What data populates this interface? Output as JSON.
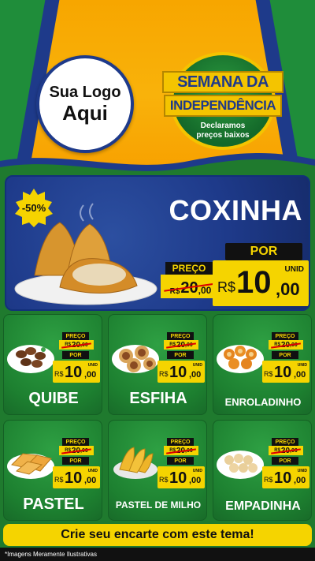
{
  "logo": {
    "line1": "Sua Logo",
    "line2": "Aqui"
  },
  "seal": {
    "line1": "SEMANA DA",
    "line2": "INDEPENDÊNCIA",
    "subtitle_line1": "Declaramos",
    "subtitle_line2": "preços baixos"
  },
  "hero": {
    "discount_badge": "-50%",
    "product_name": "COXINHA",
    "preco_label": "PREÇO",
    "old_price": {
      "currency": "R$",
      "int": "20",
      "dec": ",00"
    },
    "por_label": "POR",
    "unit_label": "UNID",
    "new_price": {
      "currency": "R$",
      "int": "10",
      "dec": ",00"
    }
  },
  "products": [
    {
      "name": "QUIBE",
      "preco_label": "PREÇO",
      "old": {
        "currency": "R$",
        "int": "20",
        "dec": ",00"
      },
      "por_label": "POR",
      "unit_label": "UNID",
      "new": {
        "currency": "R$",
        "int": "10",
        "dec": ",00"
      }
    },
    {
      "name": "ESFIHA",
      "preco_label": "PREÇO",
      "old": {
        "currency": "R$",
        "int": "20",
        "dec": ",00"
      },
      "por_label": "POR",
      "unit_label": "UNID",
      "new": {
        "currency": "R$",
        "int": "10",
        "dec": ",00"
      }
    },
    {
      "name": "ENROLADINHO",
      "preco_label": "PREÇO",
      "old": {
        "currency": "R$",
        "int": "20",
        "dec": ",00"
      },
      "por_label": "POR",
      "unit_label": "UNID",
      "new": {
        "currency": "R$",
        "int": "10",
        "dec": ",00"
      }
    },
    {
      "name": "PASTEL",
      "preco_label": "PREÇO",
      "old": {
        "currency": "R$",
        "int": "20",
        "dec": ",00"
      },
      "por_label": "POR",
      "unit_label": "UNID",
      "new": {
        "currency": "R$",
        "int": "10",
        "dec": ",00"
      }
    },
    {
      "name": "PASTEL DE MILHO",
      "preco_label": "PREÇO",
      "old": {
        "currency": "R$",
        "int": "20",
        "dec": ",00"
      },
      "por_label": "POR",
      "unit_label": "UNID",
      "new": {
        "currency": "R$",
        "int": "10",
        "dec": ",00"
      }
    },
    {
      "name": "EMPADINHA",
      "preco_label": "PREÇO",
      "old": {
        "currency": "R$",
        "int": "20",
        "dec": ",00"
      },
      "por_label": "POR",
      "unit_label": "UNID",
      "new": {
        "currency": "R$",
        "int": "10",
        "dec": ",00"
      }
    }
  ],
  "cta": "Crie seu encarte com este tema!",
  "disclaimer": "*Imagens Meramente Ilustrativas",
  "colors": {
    "green": "#1f8d3a",
    "blue": "#1e3a8a",
    "yellow": "#f5d400",
    "orange": "#f7a600"
  }
}
